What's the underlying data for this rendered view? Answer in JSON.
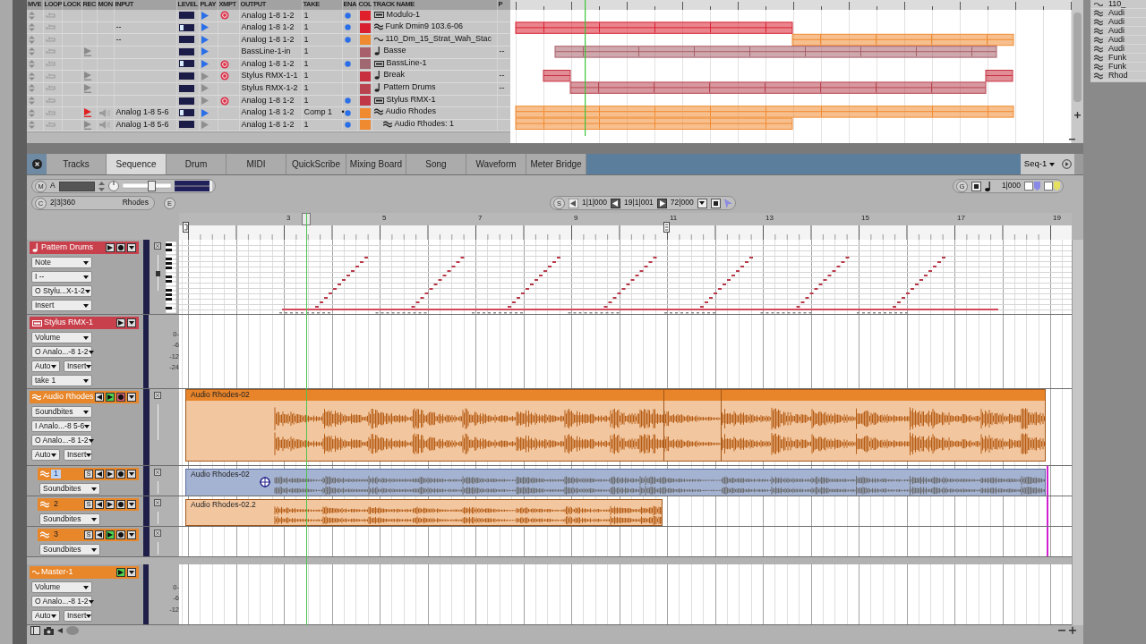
{
  "track_list": {
    "columns": [
      "MVE",
      "LOOP",
      "LOCK",
      "REC",
      "MON",
      "INPUT",
      "LEVEL",
      "PLAY",
      "XMPT",
      "OUTPUT",
      "TAKE",
      "ENA",
      "COL",
      "TRACK NAME",
      "P"
    ],
    "rows": [
      {
        "level_lit": false,
        "play_enabled": true,
        "xmpt": true,
        "output": "Analog 1-8 1-2",
        "take": "1",
        "enabled": true,
        "color": "#e0202a",
        "kind": "instrument",
        "name": "Modulo-1"
      },
      {
        "input": "--",
        "level_lit": true,
        "play_enabled": true,
        "output": "Analog 1-8 1-2",
        "take": "1",
        "enabled": true,
        "color": "#d82030",
        "kind": "audio",
        "name": "Funk Dmin9 103.6-06"
      },
      {
        "input": "--",
        "level_lit": false,
        "play_enabled": true,
        "output": "Analog 1-8 1-2",
        "take": "1",
        "enabled": true,
        "color": "#f08a30",
        "kind": "loop",
        "name": "110_Dm_15_Strat_Wah_Stac"
      },
      {
        "record_armed": false,
        "level_lit": false,
        "play_enabled": true,
        "output": "BassLine-1-in",
        "take": "1",
        "color": "#a8606a",
        "kind": "midi",
        "name": "Basse",
        "pa": "--"
      },
      {
        "level_lit": true,
        "play_enabled": true,
        "xmpt": true,
        "output": "Analog 1-8 1-2",
        "take": "1",
        "enabled": true,
        "color": "#a06870",
        "kind": "instrument",
        "name": "BassLine-1"
      },
      {
        "record_armed": false,
        "level_lit": false,
        "play_enabled": false,
        "xmpt": true,
        "output": "Stylus RMX-1-1",
        "take": "1",
        "color": "#c83040",
        "kind": "midi",
        "name": "Break",
        "pa": "--"
      },
      {
        "record_armed": false,
        "level_lit": false,
        "play_enabled": false,
        "output": "Stylus RMX-1-2",
        "take": "1",
        "color": "#b84450",
        "kind": "midi",
        "name": "Pattern Drums",
        "pa": "--"
      },
      {
        "level_lit": false,
        "play_enabled": false,
        "xmpt": true,
        "output": "Analog 1-8 1-2",
        "take": "1",
        "enabled": true,
        "color": "#c03848",
        "kind": "instrument",
        "name": "Stylus RMX-1"
      },
      {
        "record_armed": true,
        "monitor": true,
        "input": "Analog 1-8 5-6",
        "level_lit": true,
        "play_enabled": true,
        "output": "Analog 1-8 1-2",
        "take": "Comp 1",
        "take_marker": "•",
        "enabled": true,
        "color": "#f08a30",
        "kind": "audio",
        "name": "Audio Rhodes",
        "children": [
          {
            "record_armed": false,
            "monitor": true,
            "input": "Analog 1-8 5-6",
            "level_lit": false,
            "play_enabled": false,
            "output": "Analog 1-8 1-2",
            "take": "1",
            "enabled": true,
            "color": "#f08a30",
            "kind": "audio",
            "name": "Audio Rhodes: 1"
          }
        ]
      }
    ]
  },
  "mini_list": [
    {
      "kind": "loop",
      "name": "110_"
    },
    {
      "kind": "audio",
      "name": "Audi"
    },
    {
      "kind": "audio",
      "name": "Audi"
    },
    {
      "kind": "audio",
      "name": "Audi"
    },
    {
      "kind": "audio",
      "name": "Audi"
    },
    {
      "kind": "audio",
      "name": "Audi"
    },
    {
      "kind": "audio",
      "name": "Funk"
    },
    {
      "kind": "audio",
      "name": "Funk"
    },
    {
      "kind": "audio",
      "name": "Rhod"
    }
  ],
  "sequence_window": {
    "tabs": [
      {
        "label": "Tracks",
        "selected": false
      },
      {
        "label": "Sequence",
        "selected": true
      },
      {
        "label": "Drum",
        "selected": false
      },
      {
        "label": "MIDI",
        "selected": false
      },
      {
        "label": "QuickScribe",
        "selected": false
      },
      {
        "label": "Mixing Board",
        "selected": false
      },
      {
        "label": "Song",
        "selected": false
      },
      {
        "label": "Waveform",
        "selected": false
      },
      {
        "label": "Meter Bridge",
        "selected": false
      }
    ],
    "sequence_menu": "Seq-1",
    "toolbar": {
      "m": "M",
      "a": "A",
      "c": "C",
      "position": "2|3|360",
      "track": "Rhodes",
      "e": "E",
      "s": "S",
      "start": "1|1|000",
      "end": "19|1|001",
      "length": "72|000",
      "g": "G",
      "grid": "1|000",
      "slider": {
        "level": 0.62
      }
    },
    "ruler": {
      "bars": [
        "3",
        "5",
        "7",
        "9",
        "11",
        "13",
        "15",
        "17",
        "19"
      ]
    },
    "lanes": [
      {
        "kind": "midi",
        "name": "Pattern Drums",
        "color": "#c8404c",
        "buttons": [
          {
            "kind": "play",
            "on": false
          },
          {
            "kind": "record",
            "on": false
          },
          {
            "kind": "menu"
          }
        ],
        "controls": [
          [
            "Note"
          ],
          [
            "I --"
          ],
          [
            "O Stylu...X-1-2"
          ],
          [
            "Insert"
          ]
        ]
      },
      {
        "kind": "instrument",
        "name": "Stylus RMX-1",
        "color": "#c8404c",
        "buttons": [
          {
            "kind": "play",
            "on": false
          },
          {
            "kind": "menu"
          }
        ],
        "controls": [
          [
            "Volume"
          ],
          [
            "O Analo...-8 1-2"
          ],
          [
            "Auto",
            "Insert"
          ],
          [
            "take 1"
          ]
        ],
        "scale": [
          "0-",
          "-6",
          "-12",
          "-24"
        ]
      },
      {
        "kind": "audio",
        "name": "Audio Rhodes",
        "color": "#e8862a",
        "buttons": [
          {
            "kind": "rewind"
          },
          {
            "kind": "play",
            "on": true
          },
          {
            "kind": "record",
            "on": true
          },
          {
            "kind": "menu"
          }
        ],
        "controls": [
          [
            "Soundbites"
          ],
          [
            "I Analo...-8 5-6"
          ],
          [
            "O Analo...-8 1-2"
          ],
          [
            "Auto",
            "Insert"
          ]
        ],
        "clips": [
          {
            "name": "Audio Rhodes-02",
            "selected": false
          }
        ]
      },
      {
        "kind": "take",
        "name": "1",
        "selected": true,
        "color": "#e8862a",
        "buttons": [
          {
            "kind": "solo",
            "label": "S"
          },
          {
            "kind": "rewind"
          },
          {
            "kind": "play",
            "on": false
          },
          {
            "kind": "record",
            "on": false
          },
          {
            "kind": "menu"
          }
        ],
        "controls": [
          [
            "Soundbites"
          ]
        ],
        "clips": [
          {
            "name": "Audio Rhodes-02",
            "selected": true
          }
        ]
      },
      {
        "kind": "take",
        "name": "2",
        "selected": false,
        "color": "#e8862a",
        "buttons": [
          {
            "kind": "solo",
            "label": "S"
          },
          {
            "kind": "rewind"
          },
          {
            "kind": "play",
            "on": false
          },
          {
            "kind": "record",
            "on": false
          },
          {
            "kind": "menu"
          }
        ],
        "controls": [
          [
            "Soundbites"
          ]
        ],
        "clips": [
          {
            "name": "Audio Rhodes-02.2",
            "selected": false
          }
        ]
      },
      {
        "kind": "take",
        "name": "3",
        "selected": false,
        "color": "#e8862a",
        "buttons": [
          {
            "kind": "solo",
            "label": "S"
          },
          {
            "kind": "rewind"
          },
          {
            "kind": "play",
            "on": true
          },
          {
            "kind": "record",
            "on": false
          },
          {
            "kind": "menu"
          }
        ],
        "controls": [
          [
            "Soundbites"
          ]
        ]
      },
      {
        "kind": "master",
        "name": "Master-1",
        "color": "#e8862a",
        "buttons": [
          {
            "kind": "play",
            "on": true
          },
          {
            "kind": "menu"
          }
        ],
        "controls": [
          [
            "Volume"
          ],
          [
            "O Analo...-8 1-2"
          ],
          [
            "Auto",
            "Insert"
          ]
        ],
        "scale": [
          "0-",
          "-6",
          "-12"
        ]
      }
    ]
  }
}
